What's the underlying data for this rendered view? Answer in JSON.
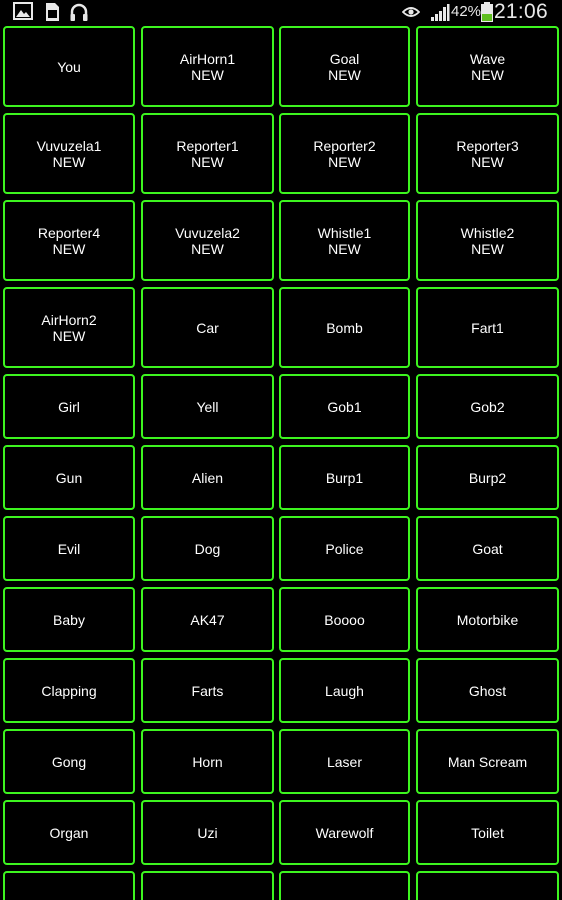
{
  "status_bar": {
    "battery_percent": "42%",
    "time": "21:06",
    "icons": [
      "gallery-icon",
      "sd-card-icon",
      "headphones-icon",
      "eye-icon",
      "signal-icon",
      "battery-icon"
    ]
  },
  "colors": {
    "accent": "#3df51f",
    "background": "#000000",
    "text": "#ffffff"
  },
  "buttons": [
    {
      "label": "You",
      "badge": ""
    },
    {
      "label": "AirHorn1",
      "badge": "NEW"
    },
    {
      "label": "Goal",
      "badge": "NEW"
    },
    {
      "label": "Wave",
      "badge": "NEW"
    },
    {
      "label": "Vuvuzela1",
      "badge": "NEW"
    },
    {
      "label": "Reporter1",
      "badge": "NEW"
    },
    {
      "label": "Reporter2",
      "badge": "NEW"
    },
    {
      "label": "Reporter3",
      "badge": "NEW"
    },
    {
      "label": "Reporter4",
      "badge": "NEW"
    },
    {
      "label": "Vuvuzela2",
      "badge": "NEW"
    },
    {
      "label": "Whistle1",
      "badge": "NEW"
    },
    {
      "label": "Whistle2",
      "badge": "NEW"
    },
    {
      "label": "AirHorn2",
      "badge": "NEW"
    },
    {
      "label": "Car",
      "badge": ""
    },
    {
      "label": "Bomb",
      "badge": ""
    },
    {
      "label": "Fart1",
      "badge": ""
    },
    {
      "label": "Girl",
      "badge": ""
    },
    {
      "label": "Yell",
      "badge": ""
    },
    {
      "label": "Gob1",
      "badge": ""
    },
    {
      "label": "Gob2",
      "badge": ""
    },
    {
      "label": "Gun",
      "badge": ""
    },
    {
      "label": "Alien",
      "badge": ""
    },
    {
      "label": "Burp1",
      "badge": ""
    },
    {
      "label": "Burp2",
      "badge": ""
    },
    {
      "label": "Evil",
      "badge": ""
    },
    {
      "label": "Dog",
      "badge": ""
    },
    {
      "label": "Police",
      "badge": ""
    },
    {
      "label": "Goat",
      "badge": ""
    },
    {
      "label": "Baby",
      "badge": ""
    },
    {
      "label": "AK47",
      "badge": ""
    },
    {
      "label": "Boooo",
      "badge": ""
    },
    {
      "label": "Motorbike",
      "badge": ""
    },
    {
      "label": "Clapping",
      "badge": ""
    },
    {
      "label": "Farts",
      "badge": ""
    },
    {
      "label": "Laugh",
      "badge": ""
    },
    {
      "label": "Ghost",
      "badge": ""
    },
    {
      "label": "Gong",
      "badge": ""
    },
    {
      "label": "Horn",
      "badge": ""
    },
    {
      "label": "Laser",
      "badge": ""
    },
    {
      "label": "Man Scream",
      "badge": ""
    },
    {
      "label": "Organ",
      "badge": ""
    },
    {
      "label": "Uzi",
      "badge": ""
    },
    {
      "label": "Warewolf",
      "badge": ""
    },
    {
      "label": "Toilet",
      "badge": ""
    },
    {
      "label": "",
      "badge": ""
    },
    {
      "label": "",
      "badge": ""
    },
    {
      "label": "",
      "badge": ""
    },
    {
      "label": "",
      "badge": ""
    }
  ]
}
